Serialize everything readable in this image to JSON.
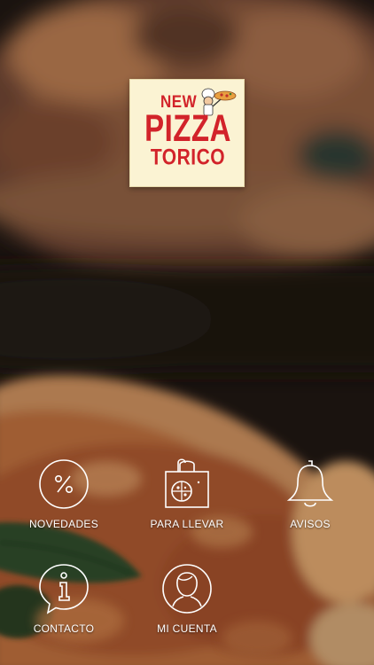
{
  "brand": {
    "name_line1": "NEW",
    "name_line2": "PIZZA",
    "name_line3": "TORICO"
  },
  "menu": [
    {
      "label": "NOVEDADES",
      "icon": "percent-icon"
    },
    {
      "label": "PARA LLEVAR",
      "icon": "takeaway-bag-icon"
    },
    {
      "label": "AVISOS",
      "icon": "bell-icon"
    },
    {
      "label": "CONTACTO",
      "icon": "info-icon"
    },
    {
      "label": "MI CUENTA",
      "icon": "user-icon"
    }
  ],
  "colors": {
    "brand_red": "#d2232a",
    "logo_background": "#fbf3d3",
    "menu_text": "#ffffff"
  }
}
